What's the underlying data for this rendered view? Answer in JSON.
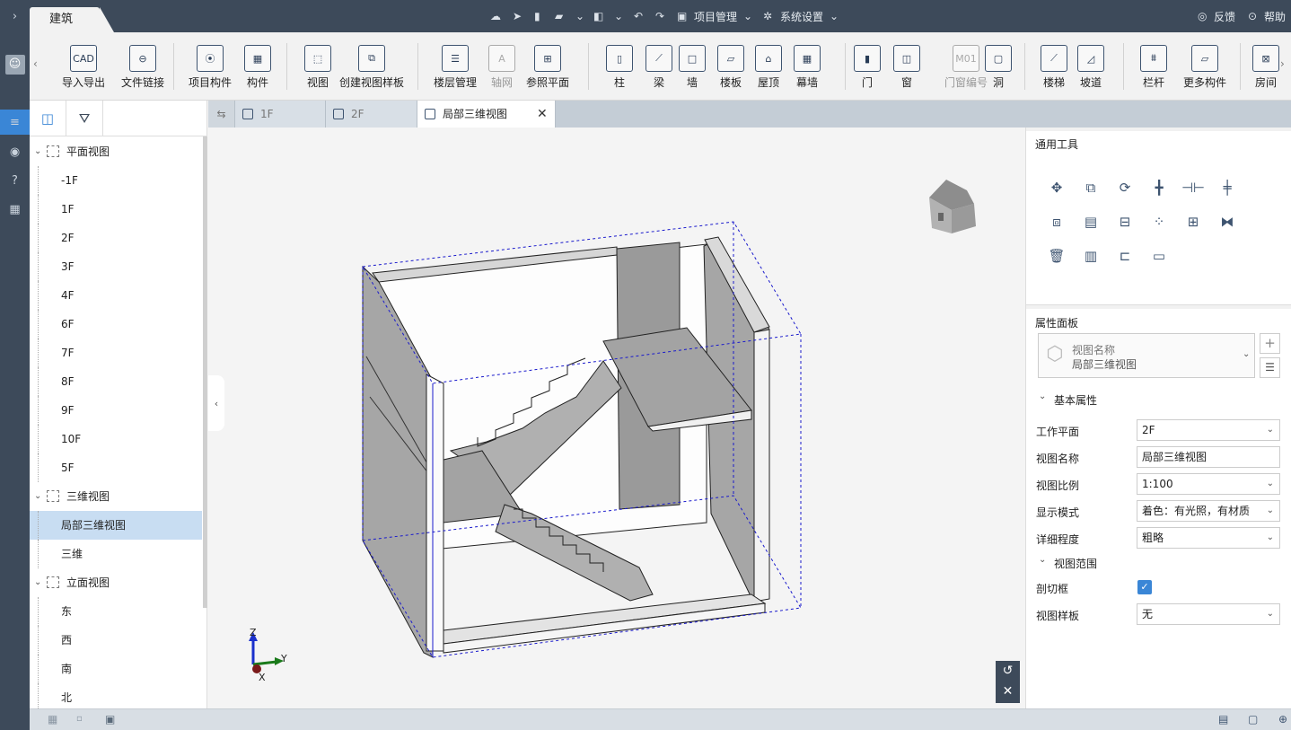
{
  "topbar": {
    "module_tab": "建筑",
    "project_menu": "项目管理",
    "settings_menu": "系统设置",
    "feedback": "反馈",
    "help": "帮助"
  },
  "ribbon": {
    "buttons": [
      {
        "label": "导入导出",
        "icon": "cad-icon",
        "glyph": "CAD"
      },
      {
        "label": "文件链接",
        "icon": "link-icon",
        "glyph": "⊖"
      },
      {
        "label": "项目构件",
        "icon": "project-component-icon",
        "glyph": "⦿"
      },
      {
        "label": "构件",
        "icon": "component-icon",
        "glyph": "▦"
      },
      {
        "label": "视图",
        "icon": "view-icon",
        "glyph": "⬚"
      },
      {
        "label": "创建视图样板",
        "icon": "view-template-icon",
        "glyph": "⧉"
      },
      {
        "label": "楼层管理",
        "icon": "floor-manage-icon",
        "glyph": "☰"
      },
      {
        "label": "轴网",
        "icon": "grid-axis-icon",
        "glyph": "A"
      },
      {
        "label": "参照平面",
        "icon": "ref-plane-icon",
        "glyph": "⊞"
      },
      {
        "label": "柱",
        "icon": "column-icon",
        "glyph": "▯"
      },
      {
        "label": "梁",
        "icon": "beam-icon",
        "glyph": "⟋"
      },
      {
        "label": "墙",
        "icon": "wall-icon",
        "glyph": "□"
      },
      {
        "label": "楼板",
        "icon": "slab-icon",
        "glyph": "▱"
      },
      {
        "label": "屋顶",
        "icon": "roof-icon",
        "glyph": "⌂"
      },
      {
        "label": "幕墙",
        "icon": "curtain-wall-icon",
        "glyph": "▦"
      },
      {
        "label": "门",
        "icon": "door-icon",
        "glyph": "▮"
      },
      {
        "label": "窗",
        "icon": "window-icon",
        "glyph": "◫"
      },
      {
        "label": "门窗编号",
        "icon": "opening-tag-icon",
        "glyph": "M01"
      },
      {
        "label": "洞",
        "icon": "hole-icon",
        "glyph": "▢"
      },
      {
        "label": "楼梯",
        "icon": "stair-icon",
        "glyph": "⟋"
      },
      {
        "label": "坡道",
        "icon": "ramp-icon",
        "glyph": "◿"
      },
      {
        "label": "栏杆",
        "icon": "railing-icon",
        "glyph": "⩩"
      },
      {
        "label": "更多构件",
        "icon": "more-components-icon",
        "glyph": "▱"
      },
      {
        "label": "房间",
        "icon": "room-icon",
        "glyph": "⊠"
      }
    ]
  },
  "left_panel": {
    "tree": [
      {
        "label": "平面视图",
        "type": "group"
      },
      {
        "label": "-1F",
        "type": "item"
      },
      {
        "label": "1F",
        "type": "item"
      },
      {
        "label": "2F",
        "type": "item"
      },
      {
        "label": "3F",
        "type": "item"
      },
      {
        "label": "4F",
        "type": "item"
      },
      {
        "label": "6F",
        "type": "item"
      },
      {
        "label": "7F",
        "type": "item"
      },
      {
        "label": "8F",
        "type": "item"
      },
      {
        "label": "9F",
        "type": "item"
      },
      {
        "label": "10F",
        "type": "item"
      },
      {
        "label": "5F",
        "type": "item"
      },
      {
        "label": "三维视图",
        "type": "group"
      },
      {
        "label": "局部三维视图",
        "type": "item",
        "selected": true
      },
      {
        "label": "三维",
        "type": "item"
      },
      {
        "label": "立面视图",
        "type": "group"
      },
      {
        "label": "东",
        "type": "item"
      },
      {
        "label": "西",
        "type": "item"
      },
      {
        "label": "南",
        "type": "item"
      },
      {
        "label": "北",
        "type": "item"
      }
    ]
  },
  "view_tabs": [
    {
      "label": "1F"
    },
    {
      "label": "2F"
    },
    {
      "label": "局部三维视图",
      "active": true
    }
  ],
  "canvas": {
    "axis_x": "X",
    "axis_y": "Y",
    "axis_z": "Z"
  },
  "right_panel": {
    "tools_title": "通用工具",
    "props_title": "属性面板",
    "type_selector": {
      "line1": "视图名称",
      "line2": "局部三维视图"
    },
    "basic_section": "基本属性",
    "range_section": "视图范围",
    "basic_props": [
      {
        "label": "工作平面",
        "value": "2F",
        "dropdown": true
      },
      {
        "label": "视图名称",
        "value": "局部三维视图",
        "dropdown": false
      },
      {
        "label": "视图比例",
        "value": "1:100",
        "dropdown": true
      },
      {
        "label": "显示模式",
        "value": "着色：有光照，有材质",
        "dropdown": true
      },
      {
        "label": "详细程度",
        "value": "粗略",
        "dropdown": true
      }
    ],
    "range_props": {
      "section_box_label": "剖切框",
      "section_box_checked": true,
      "template_label": "视图样板",
      "template_value": "无"
    }
  },
  "colors": {
    "chrome": "#3d4a5a",
    "selection": "#c8ddf2",
    "accent": "#3a86d6"
  }
}
